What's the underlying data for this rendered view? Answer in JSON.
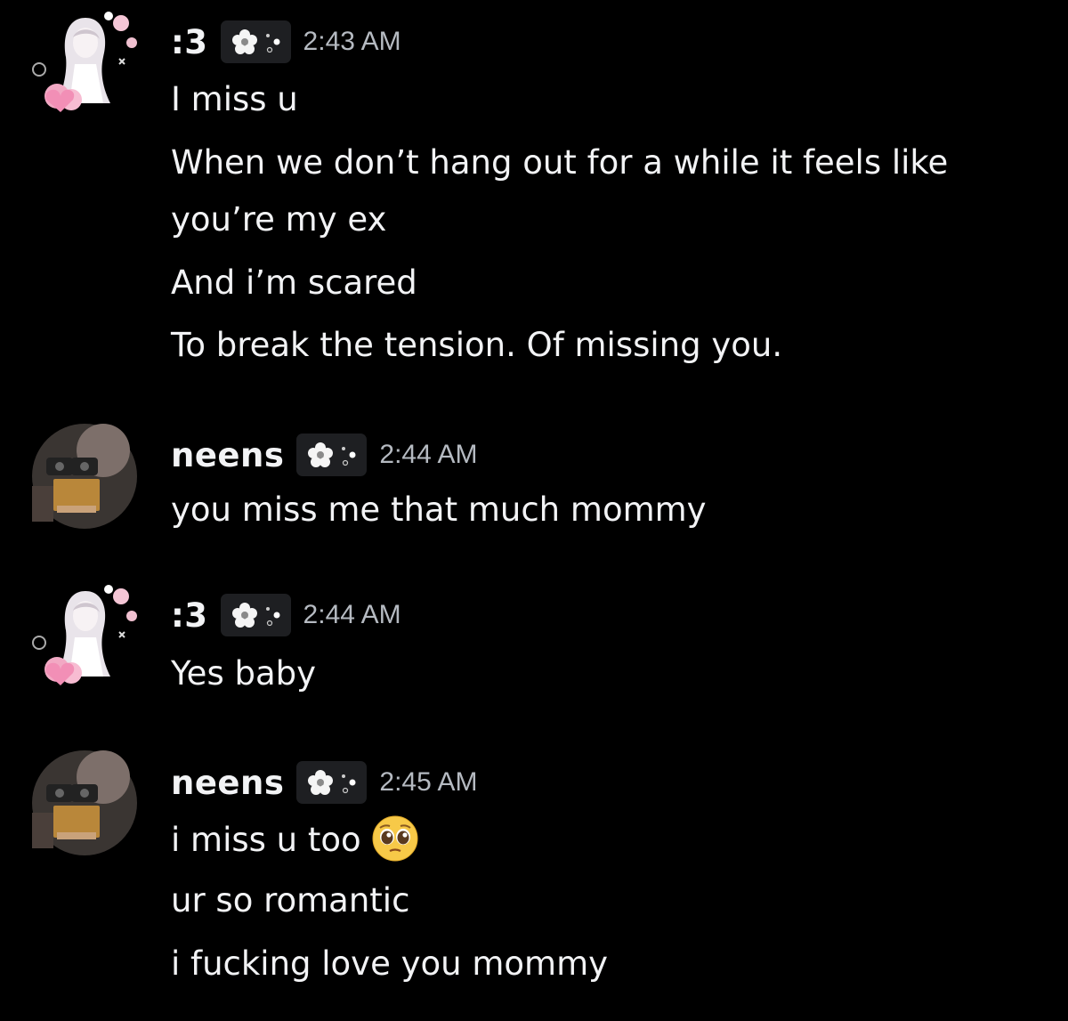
{
  "colors": {
    "background": "#000000",
    "text": "#f2f3f5",
    "timestamp": "#b5bac1",
    "tag_background": "#1e1f22"
  },
  "messages": [
    {
      "author": ":3",
      "avatar": "anime-girl-hearts-avatar",
      "tag_icon": "flower-icon",
      "time": "2:43 AM",
      "lines": [
        "I miss u",
        "When we don’t hang out for a while it feels like",
        "you’re my ex",
        "And i’m scared",
        "To break the tension. Of missing you."
      ]
    },
    {
      "author": "neens",
      "avatar": "wall-e-avatar",
      "tag_icon": "flower-icon",
      "time": "2:44 AM",
      "lines": [
        "you miss me that much mommy"
      ]
    },
    {
      "author": ":3",
      "avatar": "anime-girl-hearts-avatar",
      "tag_icon": "flower-icon",
      "time": "2:44 AM",
      "lines": [
        "Yes baby"
      ]
    },
    {
      "author": "neens",
      "avatar": "wall-e-avatar",
      "tag_icon": "flower-icon",
      "time": "2:45 AM",
      "lines": [
        "i miss u too",
        "ur so romantic",
        "i fucking love you mommy"
      ],
      "emoji": "pleading-face-emoji"
    }
  ]
}
